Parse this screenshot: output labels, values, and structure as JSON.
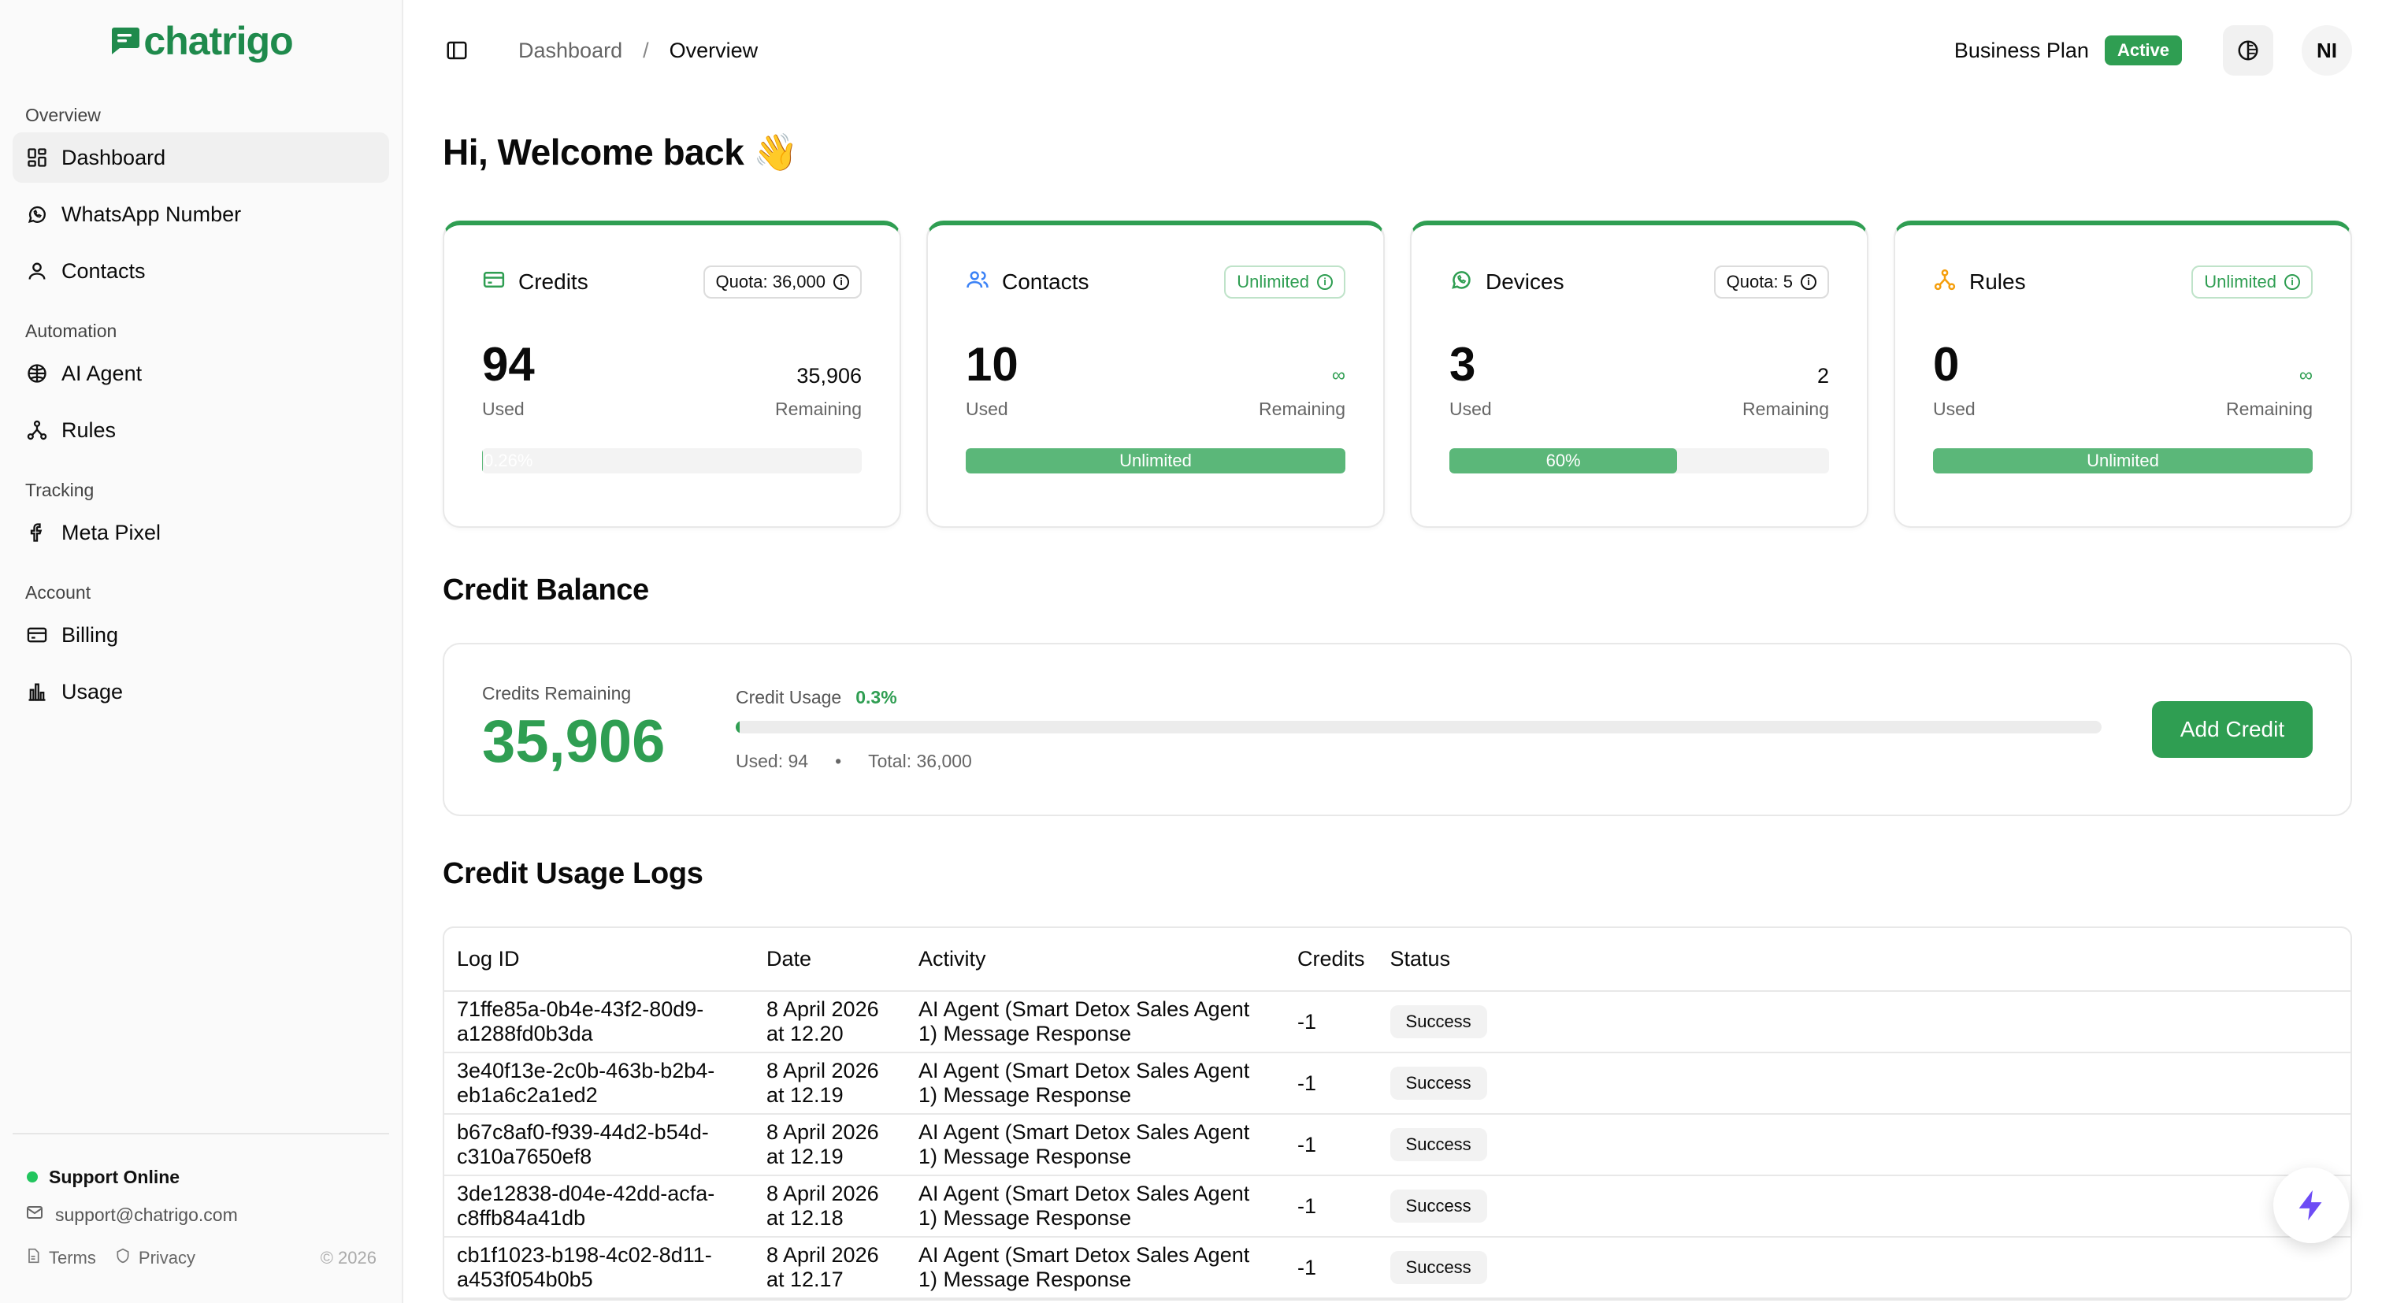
{
  "brand": {
    "name": "chatrigo",
    "color": "#1f8a4c"
  },
  "sidebar": {
    "groups": [
      {
        "label": "Overview",
        "items": [
          {
            "label": "Dashboard",
            "icon": "grid-icon",
            "active": true
          },
          {
            "label": "WhatsApp Number",
            "icon": "whatsapp-icon"
          },
          {
            "label": "Contacts",
            "icon": "user-icon"
          }
        ]
      },
      {
        "label": "Automation",
        "items": [
          {
            "label": "AI Agent",
            "icon": "bot-icon"
          },
          {
            "label": "Rules",
            "icon": "workflow-icon"
          }
        ]
      },
      {
        "label": "Tracking",
        "items": [
          {
            "label": "Meta Pixel",
            "icon": "facebook-icon"
          }
        ]
      },
      {
        "label": "Account",
        "items": [
          {
            "label": "Billing",
            "icon": "card-icon"
          },
          {
            "label": "Usage",
            "icon": "chart-icon"
          }
        ]
      }
    ],
    "footer": {
      "status": "Support Online",
      "email": "support@chatrigo.com",
      "terms": "Terms",
      "privacy": "Privacy",
      "copyright": "© 2026"
    }
  },
  "topbar": {
    "breadcrumb": [
      "Dashboard",
      "Overview"
    ],
    "plan": "Business Plan",
    "plan_status": "Active",
    "avatar_initials": "NI"
  },
  "welcome": {
    "title": "Hi, Welcome back",
    "emoji": "👋"
  },
  "cards": [
    {
      "title": "Credits",
      "icon": "credit-card-icon",
      "chip": "Quota: 36,000",
      "chip_style": "neutral",
      "used": "94",
      "used_label": "Used",
      "remaining": "35,906",
      "remaining_label": "Remaining",
      "bar_label": "0.26%",
      "bar_fill": 0.0026
    },
    {
      "title": "Contacts",
      "icon": "users-icon",
      "chip": "Unlimited",
      "chip_style": "green",
      "used": "10",
      "used_label": "Used",
      "remaining": "∞",
      "remaining_label": "Remaining",
      "bar_label": "Unlimited",
      "bar_fill": 1
    },
    {
      "title": "Devices",
      "icon": "whatsapp-icon",
      "chip": "Quota: 5",
      "chip_style": "neutral",
      "used": "3",
      "used_label": "Used",
      "remaining": "2",
      "remaining_label": "Remaining",
      "bar_label": "60%",
      "bar_fill": 0.6
    },
    {
      "title": "Rules",
      "icon": "workflow-icon",
      "chip": "Unlimited",
      "chip_style": "green",
      "used": "0",
      "used_label": "Used",
      "remaining": "∞",
      "remaining_label": "Remaining",
      "bar_label": "Unlimited",
      "bar_fill": 1
    }
  ],
  "credit_balance": {
    "title": "Credit Balance",
    "remaining_label": "Credits Remaining",
    "remaining_value": "35,906",
    "usage_label": "Credit Usage",
    "usage_pct": "0.3%",
    "usage_fill": 0.003,
    "used_text": "Used: 94",
    "separator": "•",
    "total_text": "Total: 36,000",
    "add_button": "Add Credit"
  },
  "logs": {
    "title": "Credit Usage Logs",
    "columns": [
      "Log ID",
      "Date",
      "Activity",
      "Credits",
      "Status"
    ],
    "rows": [
      [
        "71ffe85a-0b4e-43f2-80d9-a1288fd0b3da",
        "8 April 2026 at 12.20",
        "AI Agent (Smart Detox Sales Agent 1) Message Response",
        "-1",
        "Success"
      ],
      [
        "3e40f13e-2c0b-463b-b2b4-eb1a6c2a1ed2",
        "8 April 2026 at 12.19",
        "AI Agent (Smart Detox Sales Agent 1) Message Response",
        "-1",
        "Success"
      ],
      [
        "b67c8af0-f939-44d2-b54d-c310a7650ef8",
        "8 April 2026 at 12.19",
        "AI Agent (Smart Detox Sales Agent 1) Message Response",
        "-1",
        "Success"
      ],
      [
        "3de12838-d04e-42dd-acfa-c8ffb84a41db",
        "8 April 2026 at 12.18",
        "AI Agent (Smart Detox Sales Agent 1) Message Response",
        "-1",
        "Success"
      ],
      [
        "cb1f1023-b198-4c02-8d11-a453f054b0b5",
        "8 April 2026 at 12.17",
        "AI Agent (Smart Detox Sales Agent 1) Message Response",
        "-1",
        "Success"
      ]
    ]
  },
  "colors": {
    "accent": "#2f9e52",
    "bar": "#5bb779",
    "fab_bolt": "#6d4cf5"
  }
}
